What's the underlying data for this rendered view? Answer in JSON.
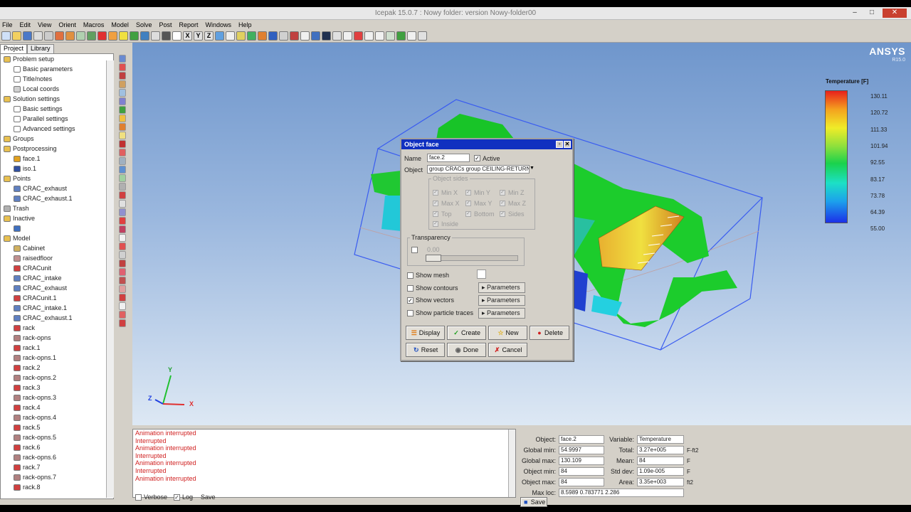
{
  "window": {
    "title": "Icepak 15.0.7 : Nowy folder: version Nowy-folder00"
  },
  "menu": [
    "File",
    "Edit",
    "View",
    "Orient",
    "Macros",
    "Model",
    "Solve",
    "Post",
    "Report",
    "Windows",
    "Help"
  ],
  "toolbar": {
    "axis_labels": [
      "X",
      "Y",
      "Z"
    ]
  },
  "tabs": [
    "Project",
    "Library"
  ],
  "tree": [
    {
      "label": "Problem setup",
      "indent": 0,
      "icon": "folder-icon"
    },
    {
      "label": "Basic parameters",
      "indent": 1,
      "icon": "doc-icon"
    },
    {
      "label": "Title/notes",
      "indent": 1,
      "icon": "doc-icon"
    },
    {
      "label": "Local coords",
      "indent": 1,
      "icon": "coords-icon"
    },
    {
      "label": "Solution settings",
      "indent": 0,
      "icon": "folder-icon"
    },
    {
      "label": "Basic settings",
      "indent": 1,
      "icon": "doc-icon"
    },
    {
      "label": "Parallel settings",
      "indent": 1,
      "icon": "doc-icon"
    },
    {
      "label": "Advanced settings",
      "indent": 1,
      "icon": "doc-icon"
    },
    {
      "label": "Groups",
      "indent": 0,
      "icon": "folder-icon"
    },
    {
      "label": "Postprocessing",
      "indent": 0,
      "icon": "folder-icon"
    },
    {
      "label": "face.1",
      "indent": 1,
      "icon": "face-icon"
    },
    {
      "label": "iso.1",
      "indent": 1,
      "icon": "iso-icon"
    },
    {
      "label": "Points",
      "indent": 0,
      "icon": "folder-icon"
    },
    {
      "label": "CRAC_exhaust",
      "indent": 1,
      "icon": "grille-icon"
    },
    {
      "label": "CRAC_exhaust.1",
      "indent": 1,
      "icon": "grille-icon"
    },
    {
      "label": "Trash",
      "indent": 0,
      "icon": "trash-icon"
    },
    {
      "label": "Inactive",
      "indent": 0,
      "icon": "folder-icon"
    },
    {
      "label": "",
      "indent": 1,
      "icon": "object-icon"
    },
    {
      "label": "Model",
      "indent": 0,
      "icon": "folder-icon"
    },
    {
      "label": "Cabinet",
      "indent": 1,
      "icon": "cabinet-icon"
    },
    {
      "label": "raisedfloor",
      "indent": 1,
      "icon": "floor-icon"
    },
    {
      "label": "CRACunit",
      "indent": 1,
      "icon": "block-icon"
    },
    {
      "label": "CRAC_intake",
      "indent": 1,
      "icon": "grille-icon"
    },
    {
      "label": "CRAC_exhaust",
      "indent": 1,
      "icon": "grille-icon"
    },
    {
      "label": "CRACunit.1",
      "indent": 1,
      "icon": "block-icon"
    },
    {
      "label": "CRAC_intake.1",
      "indent": 1,
      "icon": "grille-icon"
    },
    {
      "label": "CRAC_exhaust.1",
      "indent": 1,
      "icon": "grille-icon"
    },
    {
      "label": "rack",
      "indent": 1,
      "icon": "block-icon"
    },
    {
      "label": "rack-opns",
      "indent": 1,
      "icon": "opening-icon"
    },
    {
      "label": "rack.1",
      "indent": 1,
      "icon": "block-icon"
    },
    {
      "label": "rack-opns.1",
      "indent": 1,
      "icon": "opening-icon"
    },
    {
      "label": "rack.2",
      "indent": 1,
      "icon": "block-icon"
    },
    {
      "label": "rack-opns.2",
      "indent": 1,
      "icon": "opening-icon"
    },
    {
      "label": "rack.3",
      "indent": 1,
      "icon": "block-icon"
    },
    {
      "label": "rack-opns.3",
      "indent": 1,
      "icon": "opening-icon"
    },
    {
      "label": "rack.4",
      "indent": 1,
      "icon": "block-icon"
    },
    {
      "label": "rack-opns.4",
      "indent": 1,
      "icon": "opening-icon"
    },
    {
      "label": "rack.5",
      "indent": 1,
      "icon": "block-icon"
    },
    {
      "label": "rack-opns.5",
      "indent": 1,
      "icon": "opening-icon"
    },
    {
      "label": "rack.6",
      "indent": 1,
      "icon": "block-icon"
    },
    {
      "label": "rack-opns.6",
      "indent": 1,
      "icon": "opening-icon"
    },
    {
      "label": "rack.7",
      "indent": 1,
      "icon": "block-icon"
    },
    {
      "label": "rack-opns.7",
      "indent": 1,
      "icon": "opening-icon"
    },
    {
      "label": "rack.8",
      "indent": 1,
      "icon": "block-icon"
    }
  ],
  "viewport": {
    "brand": "ANSYS",
    "brand_version": "R15.0",
    "legend": {
      "title": "Temperature [F]",
      "ticks": [
        "130.11",
        "120.72",
        "111.33",
        "101.94",
        "92.55",
        "83.17",
        "73.78",
        "64.39",
        "55.00"
      ]
    },
    "axes": [
      "Y",
      "X",
      "Z"
    ]
  },
  "dialog": {
    "title": "Object face",
    "name_label": "Name",
    "name_value": "face.2",
    "active_label": "Active",
    "active_checked": true,
    "object_label": "Object",
    "object_value": "group CRACs group CEILING-RETURNS",
    "object_sides": {
      "title": "Object sides",
      "options": [
        "Min X",
        "Min Y",
        "Min Z",
        "Max X",
        "Max Y",
        "Max Z",
        "Top",
        "Bottom",
        "Sides",
        "Inside"
      ]
    },
    "transparency": {
      "title": "Transparency",
      "value": "0.00"
    },
    "show_mesh": {
      "label": "Show mesh",
      "checked": false
    },
    "show_contours": {
      "label": "Show contours",
      "checked": false,
      "button": "Parameters"
    },
    "show_vectors": {
      "label": "Show vectors",
      "checked": true,
      "button": "Parameters"
    },
    "show_particle_traces": {
      "label": "Show particle traces",
      "checked": false,
      "button": "Parameters"
    },
    "buttons": [
      "Display",
      "Create",
      "New",
      "Delete",
      "Reset",
      "Done",
      "Cancel"
    ]
  },
  "messages": [
    "Animation interrupted",
    "Interrupted",
    "Animation interrupted",
    "Interrupted",
    "Animation interrupted",
    "Interrupted",
    "Animation interrupted"
  ],
  "bottom_controls": {
    "verbose": "Verbose",
    "log": "Log",
    "save": "Save"
  },
  "stats": {
    "object_label": "Object:",
    "object": "face.2",
    "variable_label": "Variable:",
    "variable": "Temperature",
    "global_min_label": "Global min:",
    "global_min": "54.9997",
    "total_label": "Total:",
    "total": "3.27e+005",
    "total_unit": "F-ft2",
    "global_max_label": "Global max:",
    "global_max": "130.109",
    "mean_label": "Mean:",
    "mean": "84",
    "mean_unit": "F",
    "object_min_label": "Object min:",
    "object_min": "84",
    "std_dev_label": "Std dev:",
    "std_dev": "1.09e-005",
    "std_dev_unit": "F",
    "object_max_label": "Object max:",
    "object_max": "84",
    "area_label": "Area:",
    "area": "3.35e+003",
    "area_unit": "ft2",
    "max_loc_label": "Max loc:",
    "max_loc": "8.5989 0.783771 2.286",
    "save": "Save"
  },
  "colors": {
    "dialog_title_bar": "#1030c0",
    "message_text": "#d02020",
    "viewport_top": "#6f96cc"
  }
}
